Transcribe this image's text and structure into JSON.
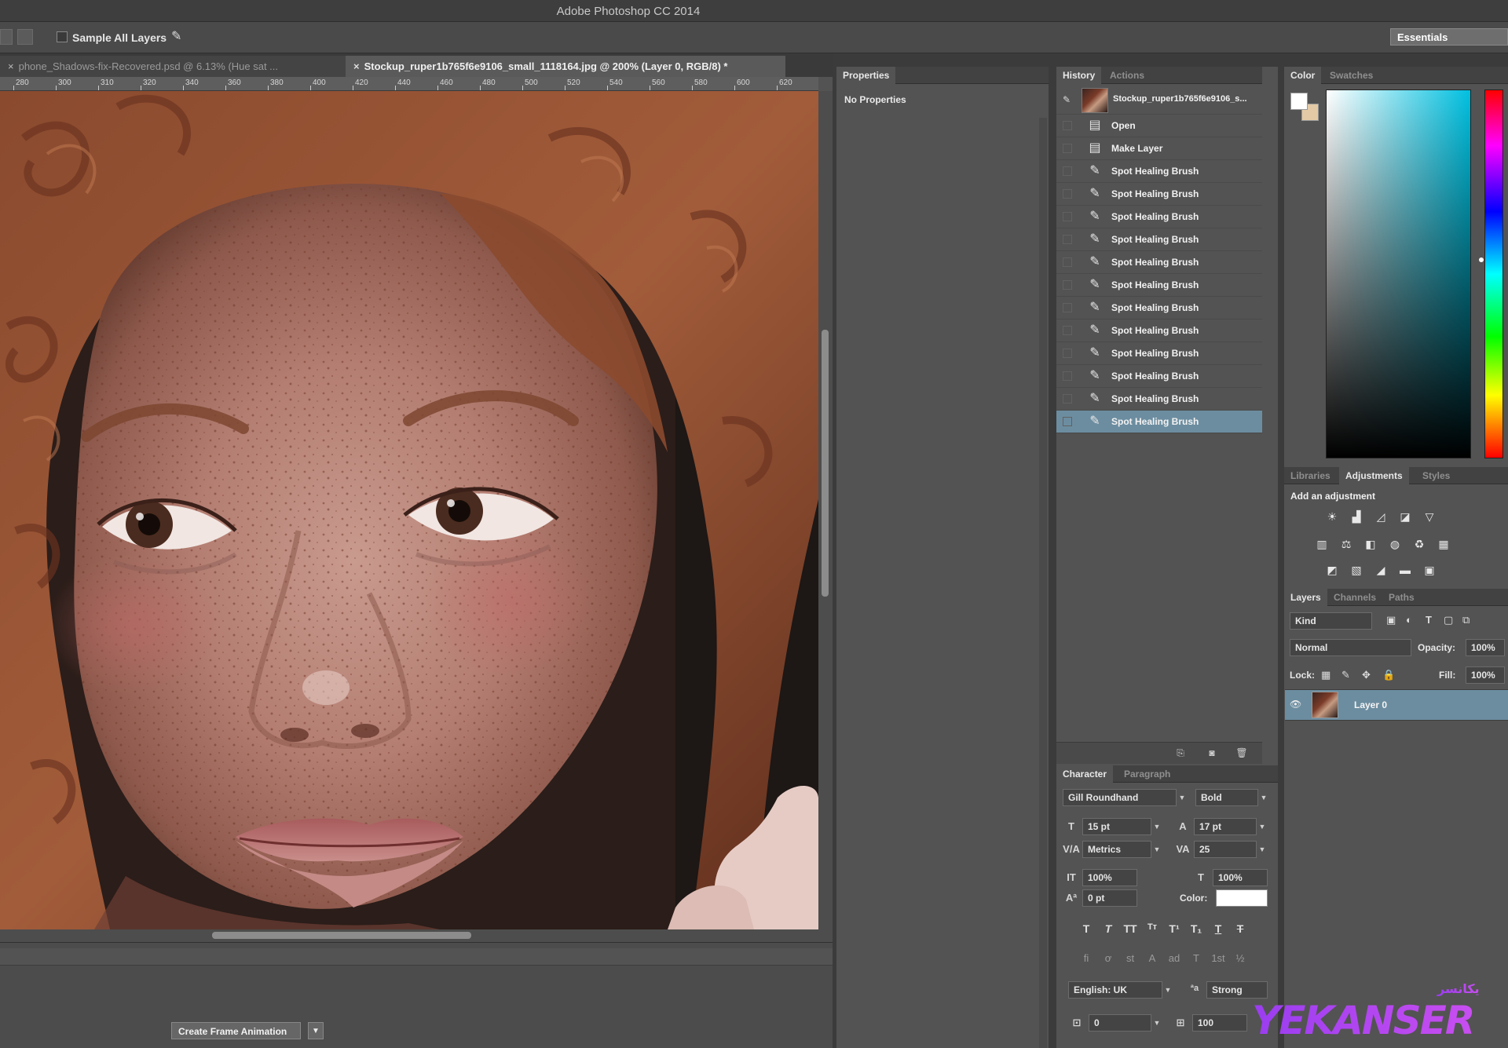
{
  "app": {
    "window_title": "Adobe Photoshop CC 2014"
  },
  "options_bar": {
    "sample_all_layers": "Sample All Layers",
    "workspace": "Essentials"
  },
  "doc_tabs": [
    {
      "label": "phone_Shadows-fix-Recovered.psd @ 6.13% (Hue sat ...",
      "active": false
    },
    {
      "label": "Stockup_ruper1b765f6e9106_small_1118164.jpg @ 200% (Layer 0, RGB/8) *",
      "active": true
    }
  ],
  "ruler": {
    "labels": [
      "280",
      "300",
      "310",
      "320",
      "340",
      "360",
      "380",
      "400",
      "420",
      "440",
      "460",
      "480",
      "500",
      "520",
      "540",
      "560",
      "580",
      "600",
      "620"
    ]
  },
  "properties": {
    "tab": "Properties",
    "empty_text": "No Properties"
  },
  "history": {
    "tabs": [
      "History",
      "Actions"
    ],
    "snapshot": "Stockup_ruper1b765f6e9106_s...",
    "items": [
      {
        "icon": "document-icon",
        "label": "Open",
        "selected": false
      },
      {
        "icon": "document-icon",
        "label": "Make Layer",
        "selected": false
      },
      {
        "icon": "brush-icon",
        "label": "Spot Healing Brush",
        "selected": false
      },
      {
        "icon": "brush-icon",
        "label": "Spot Healing Brush",
        "selected": false
      },
      {
        "icon": "brush-icon",
        "label": "Spot Healing Brush",
        "selected": false
      },
      {
        "icon": "brush-icon",
        "label": "Spot Healing Brush",
        "selected": false
      },
      {
        "icon": "brush-icon",
        "label": "Spot Healing Brush",
        "selected": false
      },
      {
        "icon": "brush-icon",
        "label": "Spot Healing Brush",
        "selected": false
      },
      {
        "icon": "brush-icon",
        "label": "Spot Healing Brush",
        "selected": false
      },
      {
        "icon": "brush-icon",
        "label": "Spot Healing Brush",
        "selected": false
      },
      {
        "icon": "brush-icon",
        "label": "Spot Healing Brush",
        "selected": false
      },
      {
        "icon": "brush-icon",
        "label": "Spot Healing Brush",
        "selected": false
      },
      {
        "icon": "brush-icon",
        "label": "Spot Healing Brush",
        "selected": false
      },
      {
        "icon": "brush-icon",
        "label": "Spot Healing Brush",
        "selected": true
      }
    ]
  },
  "character": {
    "tabs": [
      "Character",
      "Paragraph"
    ],
    "font_family": "Gill Roundhand",
    "font_style": "Bold",
    "font_size": "15 pt",
    "leading": "17 pt",
    "kerning": "Metrics",
    "tracking": "25",
    "vertical_scale": "100%",
    "horizontal_scale": "100%",
    "baseline_shift": "0 pt",
    "color_label": "Color:",
    "language": "English: UK",
    "anti_alias": "Strong",
    "extra_value_1": "0",
    "extra_value_2": "100"
  },
  "color_panel": {
    "tabs": [
      "Color",
      "Swatches"
    ],
    "field_hue": "#00c0e0"
  },
  "adjustments": {
    "tabs": [
      "Libraries",
      "Adjustments",
      "Styles"
    ],
    "title": "Add an adjustment",
    "row1": [
      "brightness-icon",
      "levels-icon",
      "curves-icon",
      "exposure-icon",
      "vibrance-icon"
    ],
    "row2": [
      "hue-saturation-icon",
      "color-balance-icon",
      "black-white-icon",
      "photo-filter-icon",
      "channel-mixer-icon",
      "color-lookup-icon"
    ],
    "row3": [
      "invert-icon",
      "posterize-icon",
      "threshold-icon",
      "gradient-map-icon",
      "selective-color-icon"
    ]
  },
  "layers": {
    "tabs": [
      "Layers",
      "Channels",
      "Paths"
    ],
    "filter_kind": "Kind",
    "blend_mode": "Normal",
    "opacity_label": "Opacity:",
    "opacity_value": "100%",
    "lock_label": "Lock:",
    "fill_label": "Fill:",
    "fill_value": "100%",
    "layer_name": "Layer 0"
  },
  "timeline": {
    "create_button": "Create Frame Animation"
  },
  "watermark": {
    "text": "YEKANSER",
    "sub": "یکانسر"
  }
}
